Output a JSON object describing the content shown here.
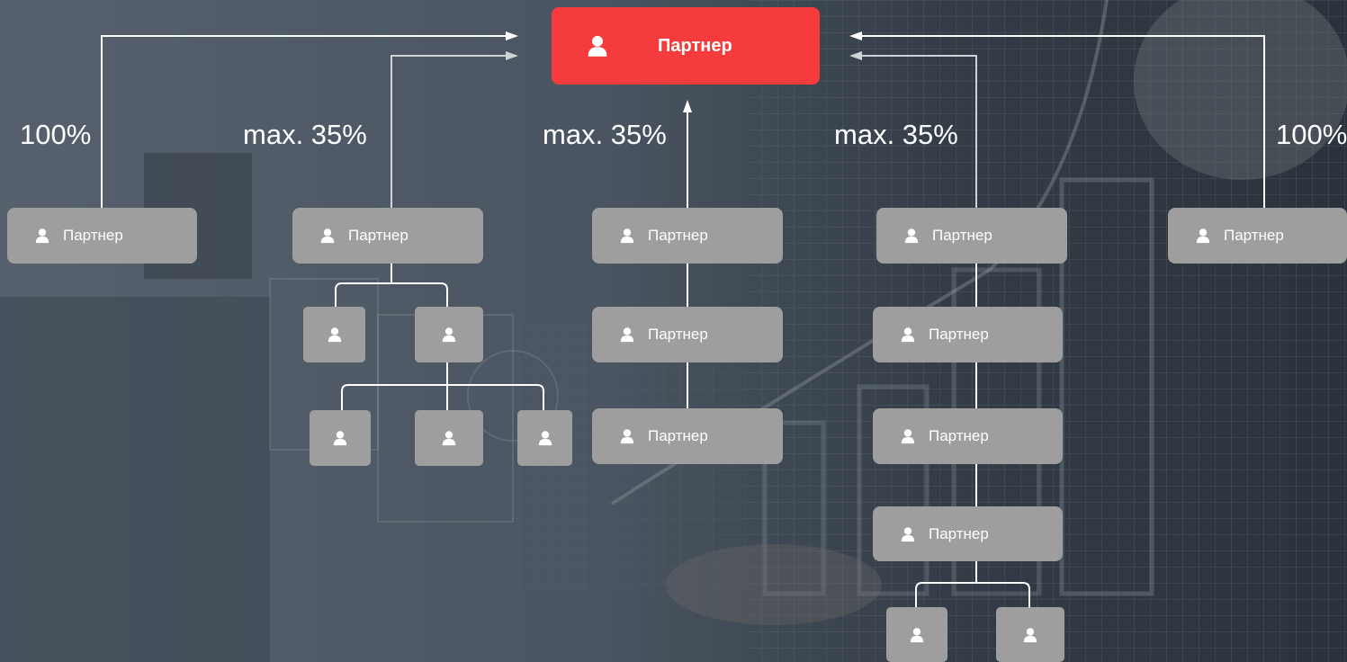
{
  "colors": {
    "root": "#f53b3b",
    "node": "#9e9e9e",
    "line": "#ffffff"
  },
  "icon": "user-icon",
  "root": {
    "label": "Партнер"
  },
  "percents": [
    "100%",
    "max. 35%",
    "max. 35%",
    "max. 35%",
    "100%"
  ],
  "nodes": {
    "c1": "Партнер",
    "c2": "Партнер",
    "c3": "Партнер",
    "c4": "Партнер",
    "c5": "Партнер",
    "c3b": "Партнер",
    "c3c": "Партнер",
    "c4b": "Партнер",
    "c4c": "Партнер",
    "c4d": "Партнер"
  }
}
